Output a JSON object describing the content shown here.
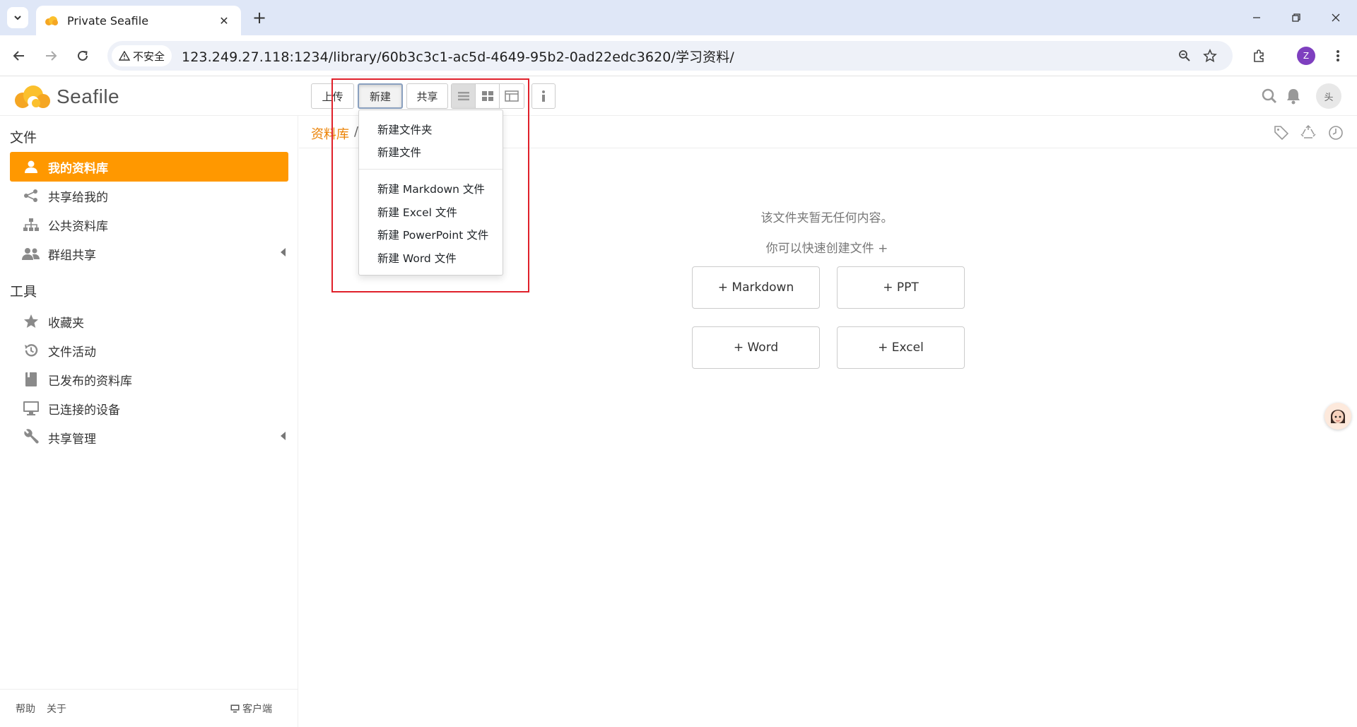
{
  "browser": {
    "tab_title": "Private Seafile",
    "security_label": "不安全",
    "url": "123.249.27.118:1234/library/60b3c3c1-ac5d-4649-95b2-0ad22edc3620/学习资料/",
    "profile_initial": "Z"
  },
  "header": {
    "logo_text": "Seafile",
    "upload_label": "上传",
    "new_label": "新建",
    "share_label": "共享",
    "avatar_alt": "头"
  },
  "sidebar": {
    "files_heading": "文件",
    "items": [
      {
        "label": "我的资料库",
        "icon": "user-icon"
      },
      {
        "label": "共享给我的",
        "icon": "share-icon"
      },
      {
        "label": "公共资料库",
        "icon": "org-tree-icon"
      },
      {
        "label": "群组共享",
        "icon": "group-icon"
      }
    ],
    "tools_heading": "工具",
    "tools": [
      {
        "label": "收藏夹",
        "icon": "star-icon"
      },
      {
        "label": "文件活动",
        "icon": "history-icon"
      },
      {
        "label": "已发布的资料库",
        "icon": "book-icon"
      },
      {
        "label": "已连接的设备",
        "icon": "monitor-icon"
      },
      {
        "label": "共享管理",
        "icon": "wrench-icon"
      }
    ],
    "footer": {
      "help": "帮助",
      "about": "关于",
      "client": "客户端"
    }
  },
  "main": {
    "breadcrumb_root": "资料库",
    "breadcrumb_sep": "/",
    "empty_message": "该文件夹暂无任何内容。",
    "quick_create_hint": "你可以快速创建文件 +",
    "create_buttons": [
      "+ Markdown",
      "+ PPT",
      "+ Word",
      "+ Excel"
    ]
  },
  "dropdown": {
    "items_top": [
      "新建文件夹",
      "新建文件"
    ],
    "items_bottom": [
      "新建 Markdown 文件",
      "新建 Excel 文件",
      "新建 PowerPoint 文件",
      "新建 Word 文件"
    ]
  },
  "colors": {
    "accent": "#ff9800",
    "link": "#eb8205",
    "highlight_box": "#e0202a"
  }
}
